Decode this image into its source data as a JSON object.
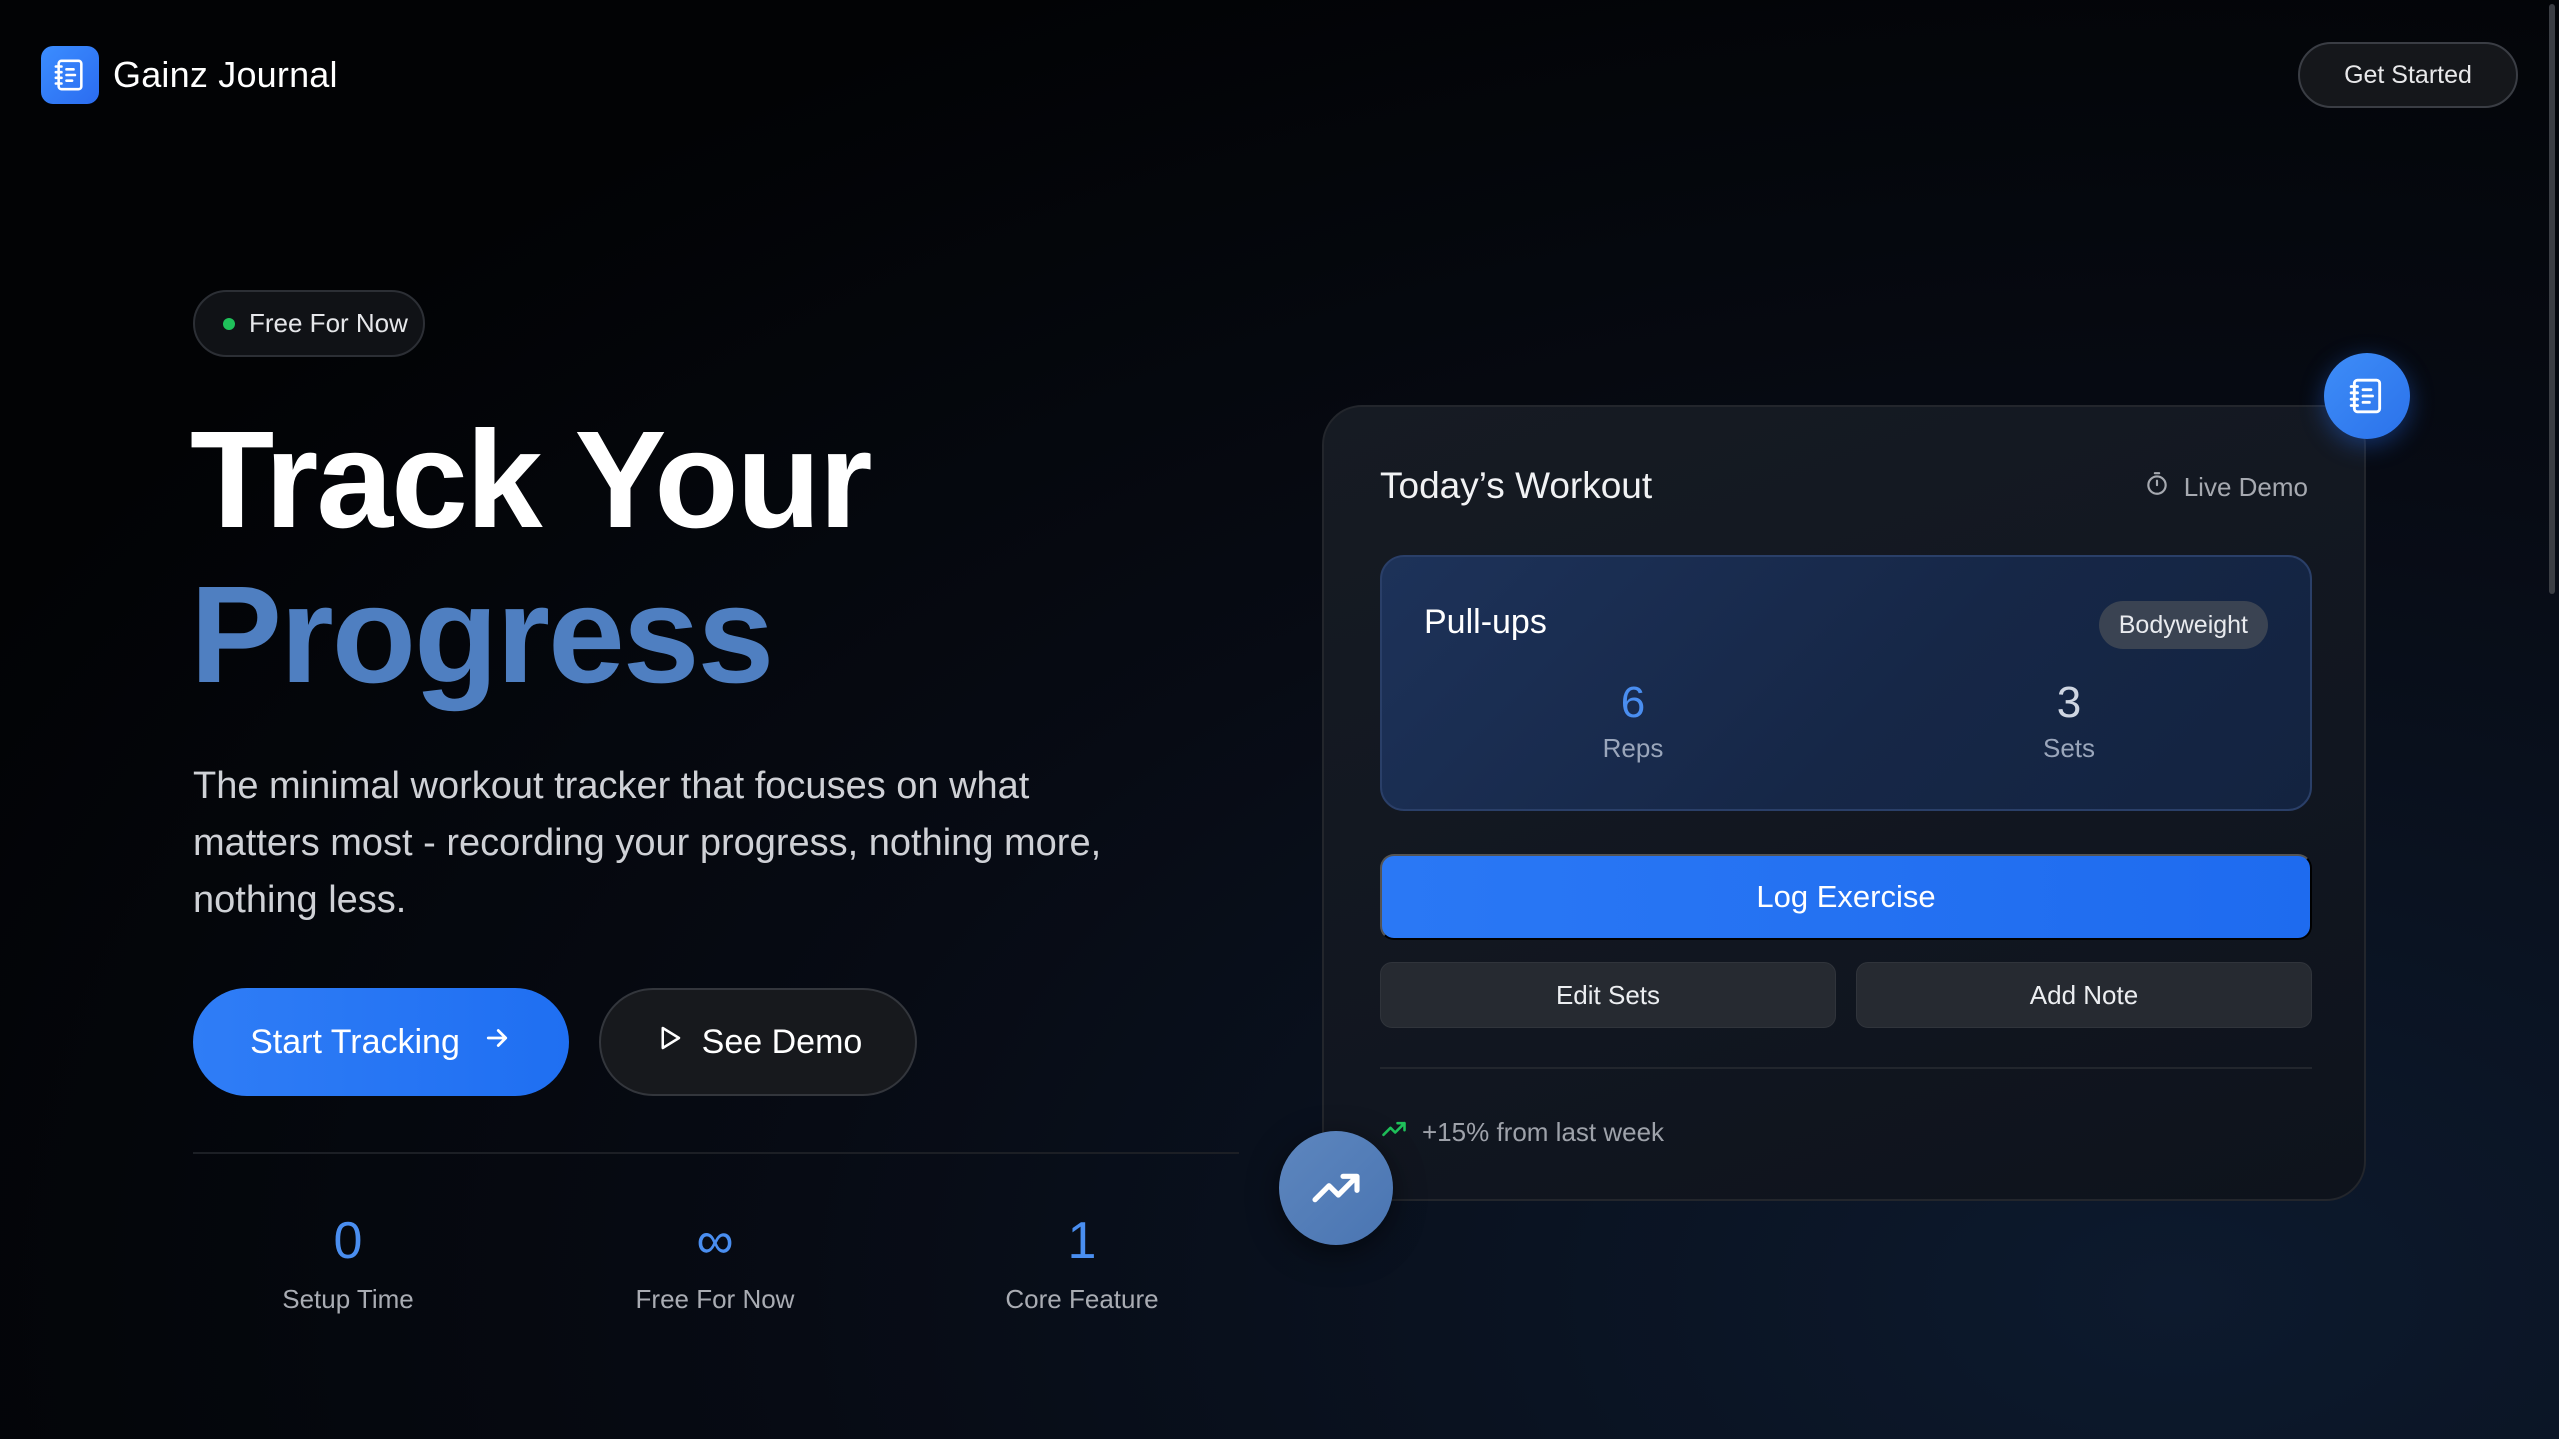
{
  "header": {
    "app_name": "Gainz Journal",
    "cta_label": "Get Started",
    "logo_icon": "notebook-icon"
  },
  "hero": {
    "badge": "Free For Now",
    "badge_color": "#1fc15a",
    "title_line1": "Track Your",
    "title_line2": "Progress",
    "title_accent_color": "#4f7fc1",
    "description": "The minimal workout tracker that focuses on what matters most - recording your progress, nothing more, nothing less.",
    "primary_button": "Start Tracking",
    "primary_button_icon": "arrow-right-icon",
    "secondary_button": "See Demo",
    "secondary_button_icon": "play-icon"
  },
  "stats": [
    {
      "value": "0",
      "label": "Setup Time"
    },
    {
      "value": "∞",
      "label": "Free For Now"
    },
    {
      "value": "1",
      "label": "Core Feature"
    }
  ],
  "demo_card": {
    "title": "Today’s Workout",
    "live_label": "Live Demo",
    "live_icon": "timer-icon",
    "exercise": {
      "name": "Pull-ups",
      "tag": "Bodyweight",
      "reps_value": "6",
      "reps_label": "Reps",
      "sets_value": "3",
      "sets_label": "Sets"
    },
    "log_button": "Log Exercise",
    "edit_button": "Edit Sets",
    "note_button": "Add Note",
    "trend_text": "+15% from last week",
    "trend_icon": "trending-up-icon",
    "trend_color": "#1fc15a"
  },
  "accent_color": "#2a78f5"
}
